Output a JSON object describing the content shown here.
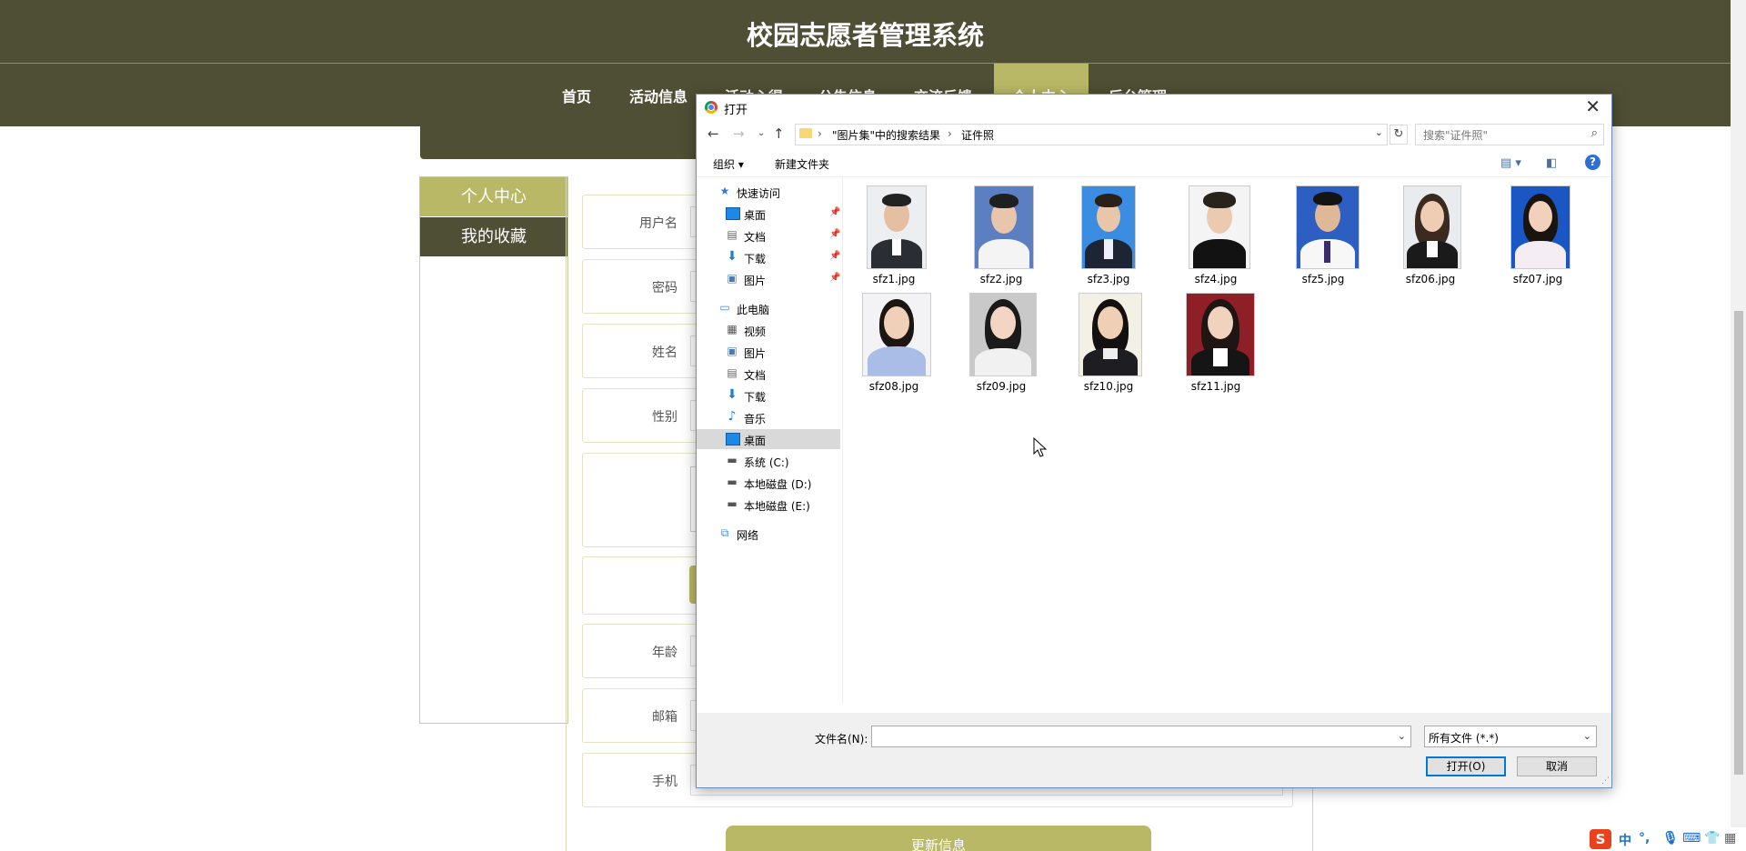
{
  "site": {
    "title": "校园志愿者管理系统",
    "nav": [
      "首页",
      "活动信息",
      "活动心得",
      "公告信息",
      "交流反馈",
      "个人中心",
      "后台管理"
    ],
    "active_nav": "个人中心",
    "sidebar": [
      "个人中心",
      "我的收藏"
    ],
    "form_labels": {
      "username": "用户名",
      "password": "密码",
      "name": "姓名",
      "gender": "性别",
      "age": "年龄",
      "email": "邮箱",
      "phone": "手机"
    },
    "update_button": "更新信息"
  },
  "dialog": {
    "title": "打开",
    "breadcrumb": [
      "\"图片集\"中的搜索结果",
      "证件照"
    ],
    "search_placeholder": "搜索\"证件照\"",
    "toolbar": {
      "organize": "组织 ▾",
      "new_folder": "新建文件夹"
    },
    "tree": {
      "quick_access": "快速访问",
      "qa_desktop": "桌面",
      "qa_documents": "文档",
      "qa_downloads": "下载",
      "qa_pictures": "图片",
      "this_pc": "此电脑",
      "pc_videos": "视频",
      "pc_pictures": "图片",
      "pc_documents": "文档",
      "pc_downloads": "下载",
      "pc_music": "音乐",
      "pc_desktop": "桌面",
      "drive_c": "系统 (C:)",
      "drive_d": "本地磁盘 (D:)",
      "drive_e": "本地磁盘 (E:)",
      "network": "网络"
    },
    "files": [
      "sfz1.jpg",
      "sfz2.jpg",
      "sfz3.jpg",
      "sfz4.jpg",
      "sfz5.jpg",
      "sfz06.jpg",
      "sfz07.jpg",
      "sfz08.jpg",
      "sfz09.jpg",
      "sfz10.jpg",
      "sfz11.jpg"
    ],
    "filename_label": "文件名(N):",
    "filename_value": "",
    "filter": "所有文件 (*.*)",
    "open_button": "打开(O)",
    "cancel_button": "取消"
  },
  "ime": {
    "logo": "S",
    "mode": "中",
    "punct": "°,"
  }
}
